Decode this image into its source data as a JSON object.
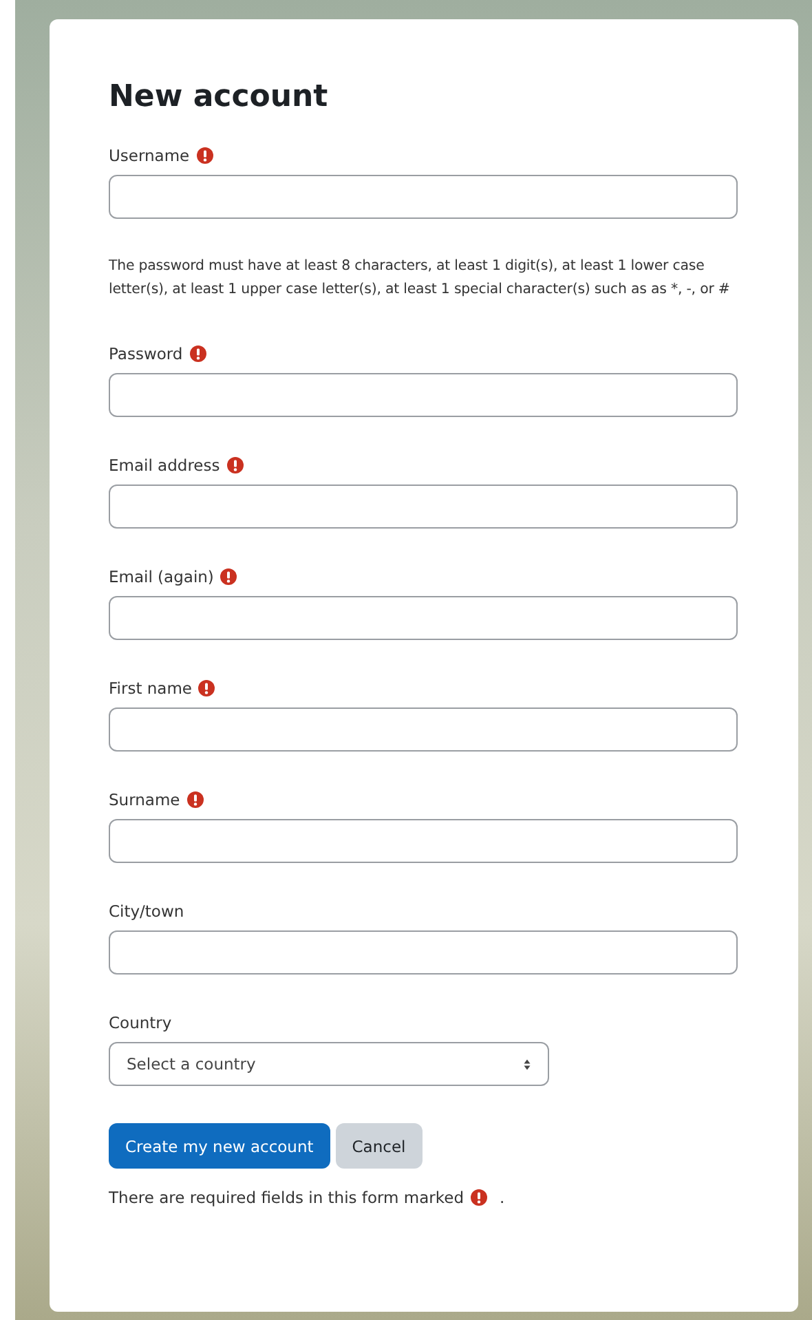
{
  "title": "New account",
  "items": [
    {
      "kind": "field",
      "label": "Username",
      "required": true
    },
    {
      "kind": "hint",
      "text": "The password must have at least 8 characters, at least 1 digit(s), at least 1 lower case letter(s), at least 1 upper case letter(s), at least 1 special character(s) such as as *, -, or #"
    },
    {
      "kind": "field",
      "label": "Password",
      "required": true
    },
    {
      "kind": "field",
      "label": "Email address",
      "required": true
    },
    {
      "kind": "field",
      "label": "Email (again)",
      "required": true
    },
    {
      "kind": "field",
      "label": "First name",
      "required": true
    },
    {
      "kind": "field",
      "label": "Surname",
      "required": true
    },
    {
      "kind": "field",
      "label": "City/town",
      "required": false
    },
    {
      "kind": "select",
      "label": "Country",
      "required": false,
      "value": "Select a country"
    }
  ],
  "buttons": [
    {
      "label": "Create my new account",
      "primary": true
    },
    {
      "label": "Cancel",
      "primary": false
    }
  ],
  "footer": {
    "text": "There are required fields in this form marked",
    "end": "."
  }
}
